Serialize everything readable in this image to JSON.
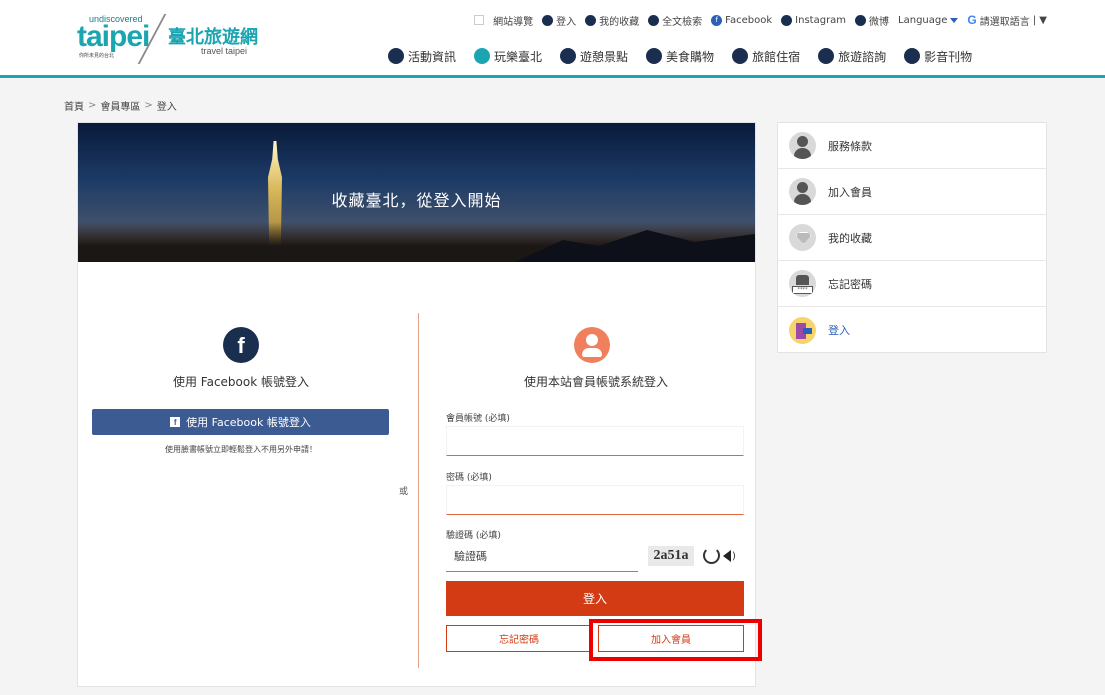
{
  "logo": {
    "undiscovered": "undiscovered",
    "taipei": "taipei",
    "tagline": "你所未見的台北",
    "name_cn": "臺北旅遊網",
    "name_en": "travel taipei"
  },
  "util_nav": {
    "sitemap": "網站導覽",
    "login": "登入",
    "favorites": "我的收藏",
    "search": "全文檢索",
    "facebook": "Facebook",
    "instagram": "Instagram",
    "weibo": "微博",
    "language": "Language",
    "select_language": "請選取語言",
    "bar_tail": "| ▼"
  },
  "main_nav": [
    {
      "label": "活動資訊"
    },
    {
      "label": "玩樂臺北"
    },
    {
      "label": "遊憩景點"
    },
    {
      "label": "美食購物"
    },
    {
      "label": "旅館住宿"
    },
    {
      "label": "旅遊諮詢"
    },
    {
      "label": "影音刊物"
    }
  ],
  "breadcrumb": {
    "home": "首頁",
    "members": "會員專區",
    "current": "登入",
    "sep": ">"
  },
  "banner": {
    "title": "收藏臺北，從登入開始"
  },
  "or_text": "或",
  "facebook_login": {
    "heading": "使用 Facebook 帳號登入",
    "button": "使用 Facebook 帳號登入",
    "note": "使用臉書帳號立即輕鬆登入不用另外申請！",
    "icon_letter": "f"
  },
  "site_login": {
    "heading": "使用本站會員帳號系統登入",
    "account_label": "會員帳號 (必填)",
    "account_value": "",
    "password_label": "密碼 (必填)",
    "password_value": "",
    "captcha_label": "驗證碼 (必填)",
    "captcha_placeholder": "驗證碼",
    "captcha_text": "2a51a",
    "login_button": "登入",
    "forgot_button": "忘記密碼",
    "join_button": "加入會員"
  },
  "sidebar": {
    "items": [
      {
        "label": "服務條款"
      },
      {
        "label": "加入會員"
      },
      {
        "label": "我的收藏"
      },
      {
        "label": "忘記密碼"
      },
      {
        "label": "登入"
      }
    ]
  },
  "colors": {
    "accent": "#1ba5b1",
    "login_button": "#d23b14",
    "facebook": "#3b5b92",
    "highlight": "#ee0000"
  }
}
